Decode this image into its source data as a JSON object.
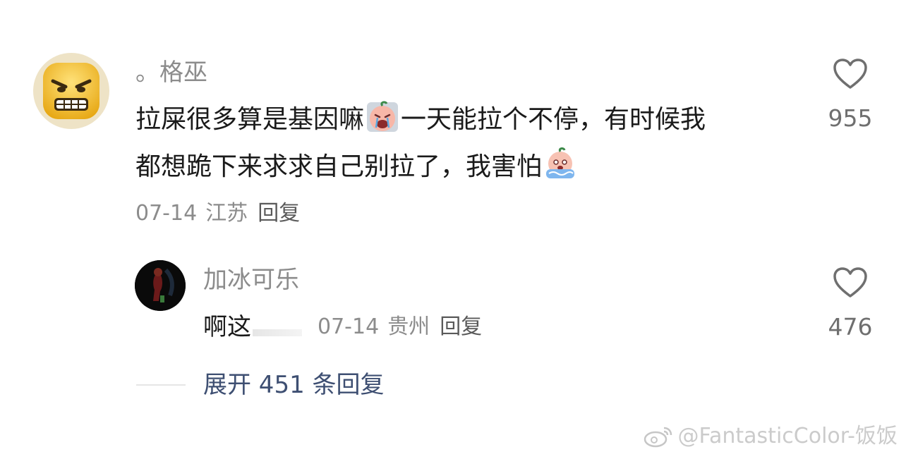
{
  "comment": {
    "username": "。格巫",
    "text_line1_part1": "拉屎很多算是基因嘛",
    "text_line1_part2": "一天能拉个不停，有时候我",
    "text_line2": "都想跪下来求求自己别拉了，我害怕",
    "emoji1": "crying-peach-emoji",
    "emoji2": "tearful-peach-emoji",
    "date": "07-14",
    "region": "江苏",
    "reply_label": "回复",
    "like_count": "955",
    "avatar": "angry-face-emoji-avatar"
  },
  "sub_reply": {
    "username": "加冰可乐",
    "text": "啊这",
    "date": "07-14",
    "region": "贵州",
    "reply_label": "回复",
    "like_count": "476",
    "avatar": "dark-figure-avatar"
  },
  "expand": {
    "label": "展开 451 条回复"
  },
  "watermark": {
    "text": "@FantasticColor-饭饭",
    "icon": "weibo-logo-icon"
  },
  "colors": {
    "username": "#8c8c8c",
    "body": "#1a1a1a",
    "link": "#3e4f72",
    "icon": "#6f6f6f"
  }
}
